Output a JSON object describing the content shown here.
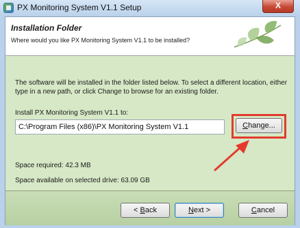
{
  "window": {
    "title": "PX Monitoring System V1.1 Setup",
    "close_label": "X"
  },
  "header": {
    "title": "Installation Folder",
    "subtitle": "Where would you like PX Monitoring System V1.1 to be installed?"
  },
  "body": {
    "description": "The software will be installed in the folder listed below. To select a different location, either type in a new path, or click Change to browse for an existing folder.",
    "install_label": "Install PX Monitoring System V1.1 to:",
    "install_path": "C:\\Program Files (x86)\\PX Monitoring System V1.1",
    "change_button": {
      "prefix": "",
      "accel": "C",
      "suffix": "hange..."
    },
    "space_required": "Space required: 42.3 MB",
    "space_available": "Space available on selected drive: 63.09 GB"
  },
  "footer": {
    "back_button": {
      "prefix": "< ",
      "accel": "B",
      "suffix": "ack"
    },
    "next_button": {
      "prefix": "",
      "accel": "N",
      "suffix": "ext >"
    },
    "cancel_button": {
      "prefix": "",
      "accel": "C",
      "suffix": "ancel"
    }
  },
  "colors": {
    "highlight": "#e33b2e",
    "body_bg": "#d6e8c6",
    "leaf": "#5f9a3c"
  },
  "icons": {
    "app": "setup-app-icon",
    "header_art": "leaf-branch-icon",
    "annotation": "red-arrow-icon"
  }
}
